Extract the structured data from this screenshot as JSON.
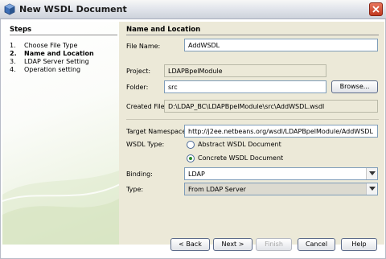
{
  "window": {
    "title": "New WSDL Document"
  },
  "steps": {
    "title": "Steps",
    "items": [
      {
        "num": "1.",
        "label": "Choose File Type"
      },
      {
        "num": "2.",
        "label": "Name and Location"
      },
      {
        "num": "3.",
        "label": "LDAP Server Setting"
      },
      {
        "num": "4.",
        "label": "Operation setting"
      }
    ]
  },
  "panel": {
    "title": "Name and Location",
    "file_name": {
      "label": "File Name:",
      "value": "AddWSDL"
    },
    "project": {
      "label": "Project:",
      "value": "LDAPBpelModule"
    },
    "folder": {
      "label": "Folder:",
      "value": "src",
      "browse": "Browse..."
    },
    "created_file": {
      "label": "Created File:",
      "value": "D:\\LDAP_BC\\LDAPBpelModule\\src\\AddWSDL.wsdl"
    },
    "target_namespace": {
      "label": "Target Namespace:",
      "value": "http://j2ee.netbeans.org/wsdl/LDAPBpelModule/AddWSDL"
    },
    "wsdl_type": {
      "label": "WSDL Type:",
      "abstract": "Abstract WSDL Document",
      "concrete": "Concrete WSDL Document",
      "selected": "concrete"
    },
    "binding": {
      "label": "Binding:",
      "value": "LDAP"
    },
    "type": {
      "label": "Type:",
      "value": "From LDAP Server"
    }
  },
  "buttons": {
    "back": "< Back",
    "next": "Next >",
    "finish": "Finish",
    "cancel": "Cancel",
    "help": "Help"
  },
  "colors": {
    "accent_green": "#2c8b2c",
    "close": "#c0391f"
  }
}
